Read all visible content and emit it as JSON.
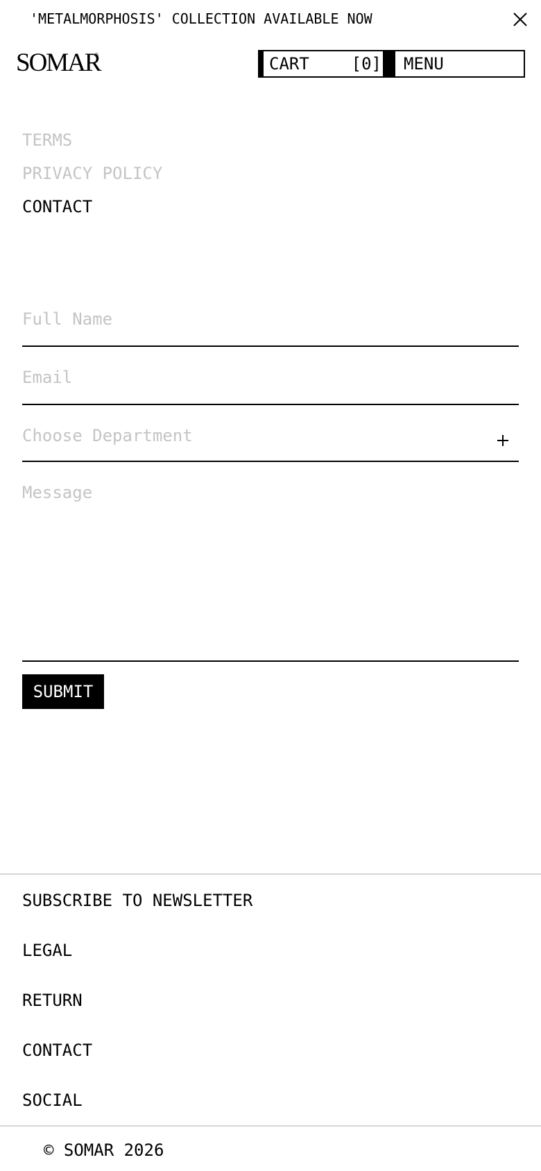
{
  "announcement": {
    "text": "'METALMORPHOSIS' COLLECTION AVAILABLE NOW",
    "close_icon": "close-icon"
  },
  "header": {
    "logo": "SOMAR",
    "cart_label": "CART",
    "cart_count": "[0]",
    "menu_label": "MENU"
  },
  "legal_nav": {
    "items": [
      {
        "label": "TERMS",
        "active": false
      },
      {
        "label": "PRIVACY POLICY",
        "active": false
      },
      {
        "label": "CONTACT",
        "active": true
      }
    ]
  },
  "contact_form": {
    "full_name_placeholder": "Full Name",
    "email_placeholder": "Email",
    "department_placeholder": "Choose Department",
    "department_icon": "plus-icon",
    "message_placeholder": "Message",
    "submit_label": "SUBMIT"
  },
  "footer": {
    "items": [
      {
        "label": "SUBSCRIBE TO NEWSLETTER"
      },
      {
        "label": "LEGAL"
      },
      {
        "label": "RETURN"
      },
      {
        "label": "CONTACT"
      },
      {
        "label": "SOCIAL"
      }
    ],
    "copyright": "© SOMAR 2026"
  },
  "colors": {
    "text": "#000000",
    "muted": "#c4c4c4",
    "rule": "#d6d6d6",
    "background": "#ffffff"
  }
}
